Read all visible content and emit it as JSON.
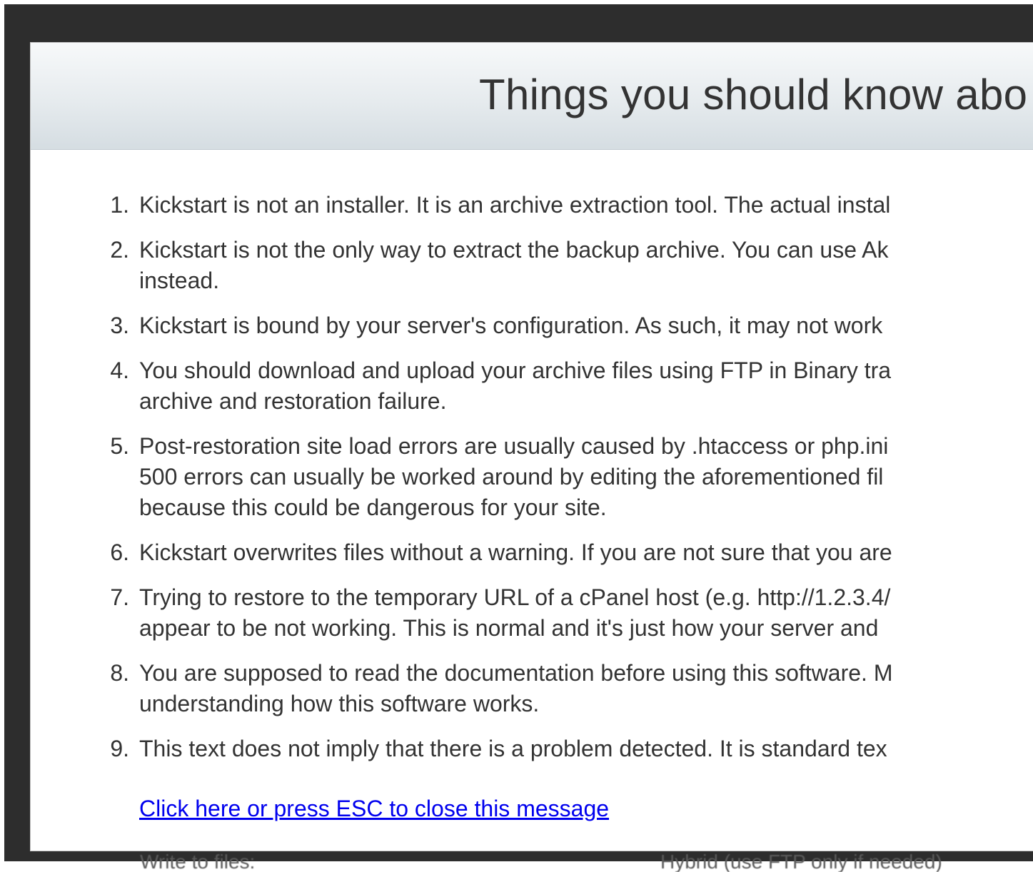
{
  "dialog": {
    "title": "Things you should know abo",
    "notes": [
      {
        "num": "1.",
        "lines": [
          "Kickstart is not an installer. It is an archive extraction tool. The actual instal"
        ]
      },
      {
        "num": "2.",
        "lines": [
          "Kickstart is not the only way to extract the backup archive. You can use Ak",
          "instead."
        ]
      },
      {
        "num": "3.",
        "lines": [
          "Kickstart is bound by your server's configuration. As such, it may not work"
        ]
      },
      {
        "num": "4.",
        "lines": [
          "You should download and upload your archive files using FTP in Binary tra",
          "archive and restoration failure."
        ]
      },
      {
        "num": "5.",
        "lines": [
          "Post-restoration site load errors are usually caused by .htaccess or php.ini",
          "500 errors can usually be worked around by editing the aforementioned fil",
          "because this could be dangerous for your site."
        ]
      },
      {
        "num": "6.",
        "lines": [
          "Kickstart overwrites files without a warning. If you are not sure that you are"
        ]
      },
      {
        "num": "7.",
        "lines": [
          "Trying to restore to the temporary URL of a cPanel host (e.g. http://1.2.3.4/",
          "appear to be not working. This is normal and it's just how your server and"
        ]
      },
      {
        "num": "8.",
        "lines": [
          "You are supposed to read the documentation before using this software. M",
          "understanding how this software works."
        ]
      },
      {
        "num": "9.",
        "lines": [
          "This text does not imply that there is a problem detected. It is standard tex"
        ]
      }
    ],
    "close_link": "Click here or press ESC to close this message"
  },
  "background": {
    "left_text": "Write to files:",
    "right_text": "Hybrid (use FTP only if needed)"
  },
  "colors": {
    "backdrop": "#2d2d2d",
    "text": "#333333",
    "link": "#0000ee"
  }
}
